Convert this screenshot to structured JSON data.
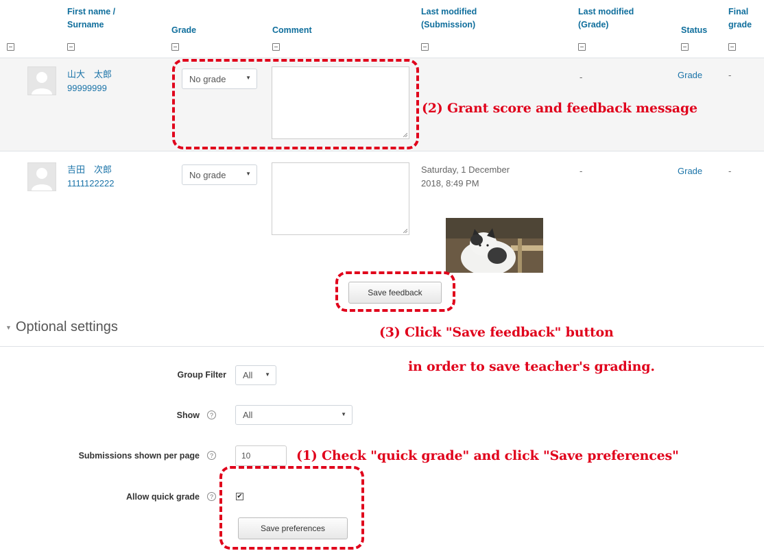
{
  "table": {
    "headers": {
      "name_line1": "First name /",
      "name_line2": "Surname",
      "grade": "Grade",
      "comment": "Comment",
      "submission_line1": "Last modified",
      "submission_line2": "(Submission)",
      "grade_mod_line1": "Last modified",
      "grade_mod_line2": "(Grade)",
      "status": "Status",
      "final_line1": "Final",
      "final_line2": "grade"
    },
    "rows": [
      {
        "name": "山大　太郎",
        "id": "99999999",
        "grade_select": "No grade",
        "submission_modified": "",
        "grade_modified": "-",
        "status": "Grade",
        "final_grade": "-"
      },
      {
        "name": "吉田　次郎",
        "id": "1111122222",
        "grade_select": "No grade",
        "submission_modified_line1": "Saturday, 1 December",
        "submission_modified_line2": "2018, 8:49 PM",
        "grade_modified": "-",
        "status": "Grade",
        "final_grade": "-"
      }
    ],
    "save_feedback_label": "Save feedback"
  },
  "optional_settings": {
    "title": "Optional settings",
    "group_filter_label": "Group Filter",
    "group_filter_value": "All",
    "show_label": "Show",
    "show_value": "All",
    "per_page_label": "Submissions shown per page",
    "per_page_value": "10",
    "quick_grade_label": "Allow quick grade",
    "quick_grade_checked": true,
    "save_preferences_label": "Save preferences"
  },
  "annotations": {
    "step2": "(2) Grant score and feedback message",
    "step3_line1": "(3) Click \"Save feedback\" button",
    "step3_line2": "in order to save teacher's grading.",
    "step1": "(1) Check \"quick grade\" and click \"Save preferences\""
  },
  "colors": {
    "link": "#0f6e9c",
    "annotation": "#e0001b",
    "row_background": "#f5f5f5"
  }
}
